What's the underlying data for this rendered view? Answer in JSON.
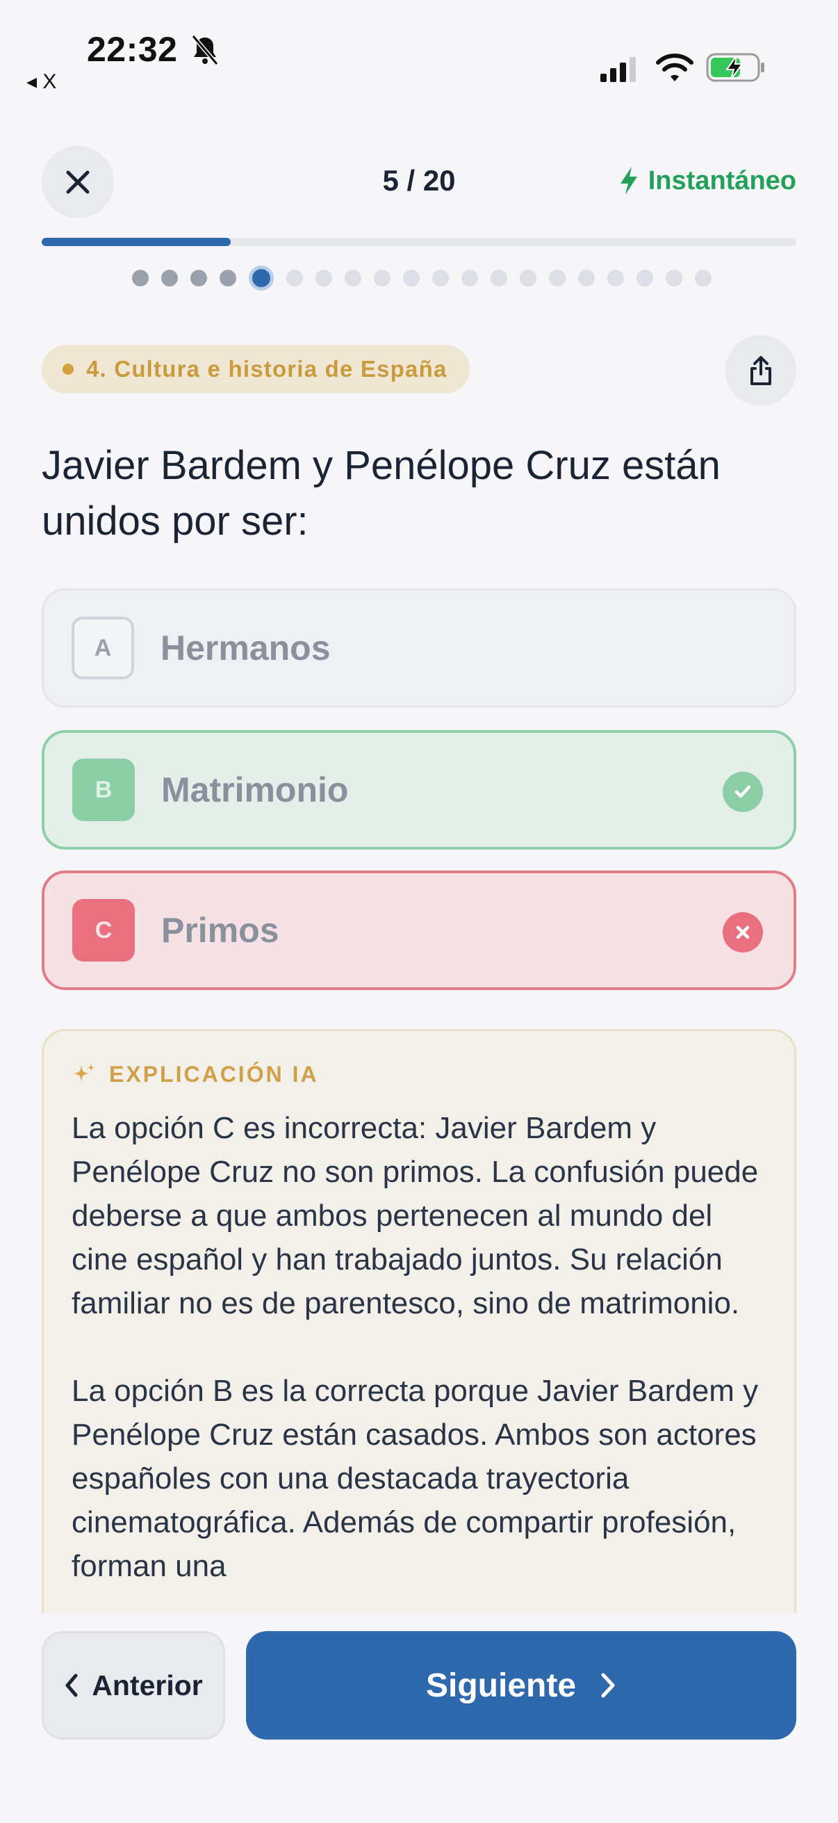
{
  "status_bar": {
    "time": "22:32",
    "back_app_label": "◂ X",
    "silent_icon": "bell-slash-icon",
    "signal_icon": "cellular-signal-icon",
    "wifi_icon": "wifi-icon",
    "battery_icon": "battery-charging-icon"
  },
  "header": {
    "close_icon": "close-icon",
    "counter": "5 / 20",
    "mode_label": "Instantáneo",
    "mode_icon": "lightning-icon",
    "progress": {
      "current": 5,
      "total": 20,
      "fraction": 0.25
    },
    "colors": {
      "accent": "#2f69ad",
      "mode": "#23a05a"
    }
  },
  "category": {
    "label": "4. Cultura e historia de España",
    "color": "#c99b3c"
  },
  "share_icon": "share-icon",
  "question": "Javier Bardem y Penélope Cruz están unidos por ser:",
  "options": [
    {
      "letter": "A",
      "label": "Hermanos",
      "state": "neutral"
    },
    {
      "letter": "B",
      "label": "Matrimonio",
      "state": "correct",
      "state_icon": "check-icon"
    },
    {
      "letter": "C",
      "label": "Primos",
      "state": "incorrect",
      "state_icon": "x-icon"
    }
  ],
  "explanation": {
    "title": "EXPLICACIÓN IA",
    "icon": "sparkle-icon",
    "paragraphs": [
      "La opción C es incorrecta: Javier Bardem y Penélope Cruz no son primos. La confusión puede deberse a que ambos pertenecen al mundo del cine español y han trabajado juntos. Su relación familiar no es de parentesco, sino de matrimonio.",
      "La opción B es la correcta porque Javier Bardem y Penélope Cruz están casados. Ambos son actores españoles con una destacada trayectoria cinematográfica. Además de compartir profesión, forman una"
    ]
  },
  "nav": {
    "prev_label": "Anterior",
    "next_label": "Siguiente",
    "prev_icon": "chevron-left-icon",
    "next_icon": "chevron-right-icon"
  }
}
